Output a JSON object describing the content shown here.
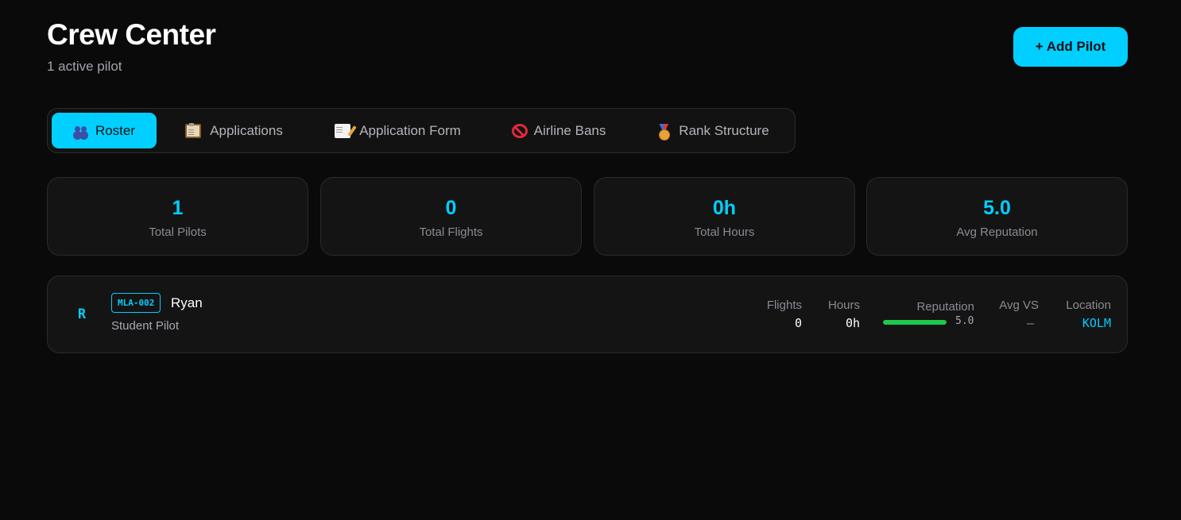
{
  "header": {
    "title": "Crew Center",
    "subtitle": "1 active pilot",
    "add_button_label": "+ Add Pilot"
  },
  "tabs": [
    {
      "label": "Roster",
      "icon": "people-icon",
      "active": true
    },
    {
      "label": "Applications",
      "icon": "clipboard-icon",
      "active": false
    },
    {
      "label": "Application Form",
      "icon": "memo-icon",
      "active": false
    },
    {
      "label": "Airline Bans",
      "icon": "no-entry-icon",
      "active": false
    },
    {
      "label": "Rank Structure",
      "icon": "medal-icon",
      "active": false
    }
  ],
  "stats": [
    {
      "value": "1",
      "label": "Total Pilots"
    },
    {
      "value": "0",
      "label": "Total Flights"
    },
    {
      "value": "0h",
      "label": "Total Hours"
    },
    {
      "value": "5.0",
      "label": "Avg Reputation"
    }
  ],
  "pilots": [
    {
      "initial": "R",
      "callsign": "MLA-002",
      "name": "Ryan",
      "rank": "Student Pilot",
      "flights_label": "Flights",
      "flights": "0",
      "hours_label": "Hours",
      "hours": "0h",
      "reputation_label": "Reputation",
      "reputation": "5.0",
      "reputation_fraction": 1.0,
      "avg_vs_label": "Avg VS",
      "avg_vs": "—",
      "location_label": "Location",
      "location": "KOLM"
    }
  ],
  "colors": {
    "accent": "#00cfff",
    "background": "#0a0a0a",
    "card": "#141414",
    "reputation_bar": "#1fc94d",
    "location_text": "#00cfff"
  }
}
